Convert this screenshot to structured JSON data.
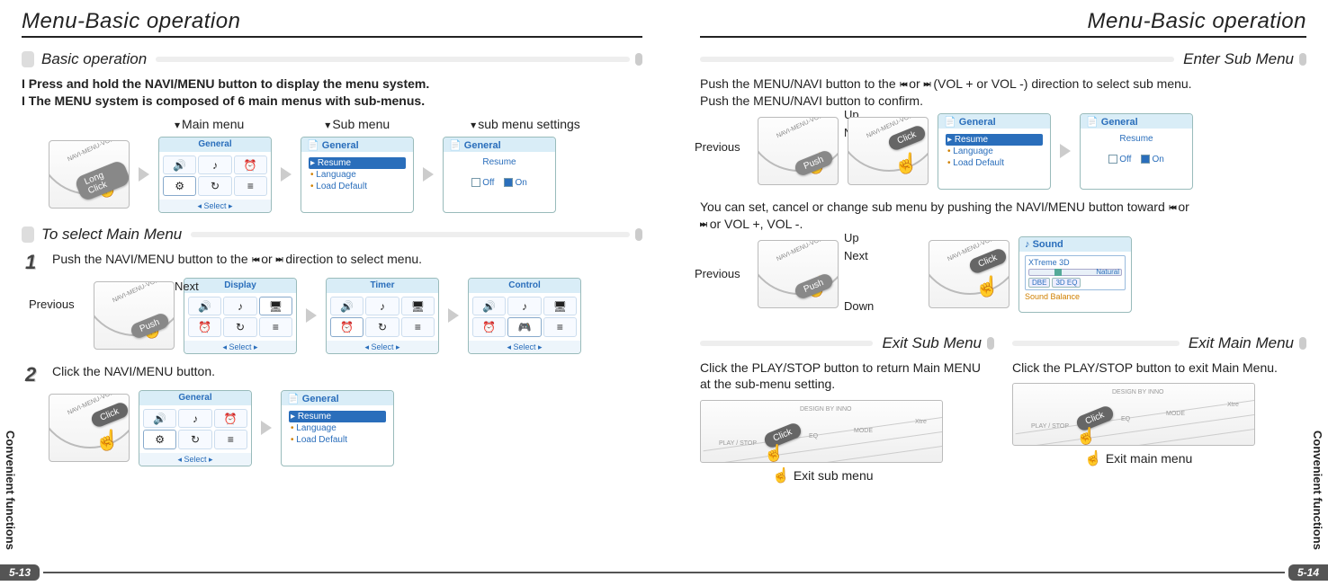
{
  "left": {
    "title": "Menu-Basic operation",
    "sidecol": "Convenient functions",
    "pagenum": "5-13",
    "sec_basic": "Basic operation",
    "intro1": "I Press and hold the NAVI/MENU button to display the menu system.",
    "intro2": "I The MENU system is composed of 6 main menus with sub-menus.",
    "legend": {
      "main": "Main menu",
      "sub": "Sub menu",
      "settings": "sub menu settings"
    },
    "tag_long_click": "Long Click",
    "dial_arc": "NAVI-MENU-VOL",
    "card_general_hdr": "General",
    "card_general_items": {
      "a": "Resume",
      "b": "Language",
      "c": "Load Default"
    },
    "card_resume_hdr": "Resume",
    "card_resume_off": "Off",
    "card_resume_on": "On",
    "card_select": "◂ Select ▸",
    "sec_select_main": "To select Main Menu",
    "step1_text": "Push the NAVI/MENU button to the",
    "step1_text_mid": "or",
    "step1_text_end": "direction to select menu.",
    "step1_prev": "Previous",
    "step1_next": "Next",
    "tag_push": "Push",
    "main_card_labels": {
      "display": "Display",
      "timer": "Timer",
      "control": "Control",
      "general": "General"
    },
    "step2_text": "Click the NAVI/MENU button.",
    "tag_click": "Click"
  },
  "right": {
    "title": "Menu-Basic operation",
    "sidecol": "Convenient functions",
    "pagenum": "5-14",
    "sec_enter_sub": "Enter Sub Menu",
    "enter1a": "Push the MENU/NAVI button to the",
    "enter1b": "or",
    "enter1c": "(VOL + or VOL -) direction to select sub menu.",
    "enter2": "Push the MENU/NAVI button to confirm.",
    "dir": {
      "up": "Up",
      "next": "Next",
      "previous": "Previous",
      "down": "Down"
    },
    "tag_push": "Push",
    "tag_click": "Click",
    "card_general_hdr": "General",
    "card_general_items": {
      "a": "Resume",
      "b": "Language",
      "c": "Load Default"
    },
    "card_resume_hdr": "Resume",
    "card_resume_off": "Off",
    "card_resume_on": "On",
    "enter3a": "You can set, cancel or change sub menu by pushing the NAVI/MENU button toward",
    "enter3b": "or",
    "enter3c": "or VOL +, VOL -.",
    "card_sound_hdr": "Sound",
    "sound": {
      "xtreme": "XTreme 3D",
      "natural": "Natural",
      "dbe": "DBE",
      "eq": "3D EQ",
      "balance": "Sound Balance"
    },
    "sec_exit_sub": "Exit Sub Menu",
    "sec_exit_main": "Exit Main Menu",
    "exit_sub_text": "Click the PLAY/STOP button to return Main MENU at the sub-menu setting.",
    "exit_main_text": "Click the PLAY/STOP button to exit Main Menu.",
    "exit_sub_label": "Exit sub menu",
    "exit_main_label": "Exit main menu",
    "strip": {
      "design": "DESIGN BY INNO",
      "play": "PLAY / STOP",
      "eq": "EQ",
      "mode": "MODE",
      "xtre": "Xtre"
    }
  }
}
